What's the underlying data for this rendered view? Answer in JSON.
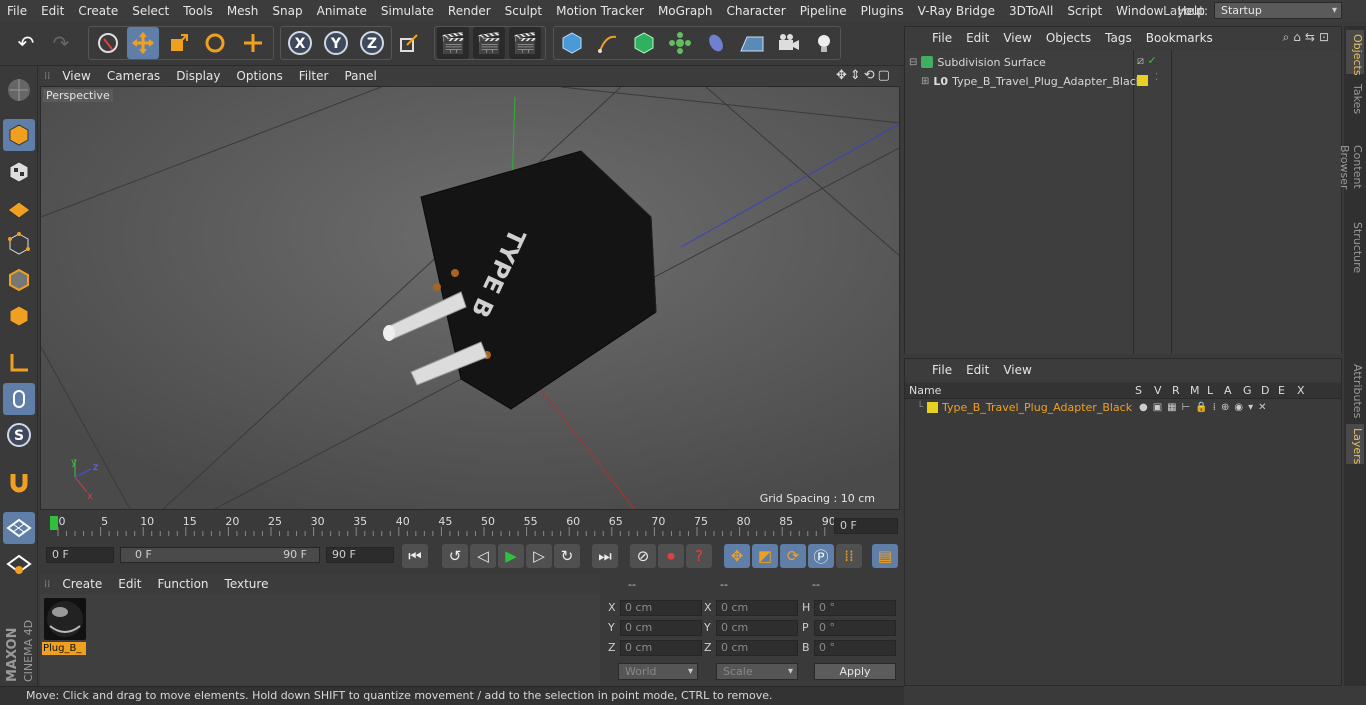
{
  "menubar": {
    "items": [
      "File",
      "Edit",
      "Create",
      "Select",
      "Tools",
      "Mesh",
      "Snap",
      "Animate",
      "Simulate",
      "Render",
      "Sculpt",
      "Motion Tracker",
      "MoGraph",
      "Character",
      "Pipeline",
      "Plugins",
      "V-Ray Bridge",
      "3DToAll",
      "Script",
      "Window",
      "Help"
    ],
    "layout_label": "Layout:",
    "layout_value": "Startup"
  },
  "viewport": {
    "menu": [
      "View",
      "Cameras",
      "Display",
      "Options",
      "Filter",
      "Panel"
    ],
    "label": "Perspective",
    "grid_spacing": "Grid Spacing : 10 cm",
    "object_text": "TYPE B"
  },
  "timeline": {
    "ticks": [
      "0",
      "5",
      "10",
      "15",
      "20",
      "25",
      "30",
      "35",
      "40",
      "45",
      "50",
      "55",
      "60",
      "65",
      "70",
      "75",
      "80",
      "85",
      "90"
    ],
    "current_frame": "0 F"
  },
  "transport": {
    "start_field": "0 F",
    "range_start": "0 F",
    "range_end": "90 F",
    "end_field": "90 F"
  },
  "material": {
    "menu": [
      "Create",
      "Edit",
      "Function",
      "Texture"
    ],
    "name": "Plug_B_"
  },
  "coords": {
    "headers": [
      "--",
      "--",
      "--"
    ],
    "rows": [
      {
        "a": "X",
        "av": "0 cm",
        "b": "X",
        "bv": "0 cm",
        "c": "H",
        "cv": "0 °"
      },
      {
        "a": "Y",
        "av": "0 cm",
        "b": "Y",
        "bv": "0 cm",
        "c": "P",
        "cv": "0 °"
      },
      {
        "a": "Z",
        "av": "0 cm",
        "b": "Z",
        "bv": "0 cm",
        "c": "B",
        "cv": "0 °"
      }
    ],
    "mode": "World",
    "scale": "Scale",
    "apply": "Apply"
  },
  "object_manager": {
    "menu": [
      "File",
      "Edit",
      "View",
      "Objects",
      "Tags",
      "Bookmarks"
    ],
    "objects": [
      {
        "name": "Subdivision Surface"
      },
      {
        "name": "Type_B_Travel_Plug_Adapter_Black"
      }
    ]
  },
  "layer_manager": {
    "menu": [
      "File",
      "Edit",
      "View"
    ],
    "headers": [
      "Name",
      "S",
      "V",
      "R",
      "M",
      "L",
      "A",
      "G",
      "D",
      "E",
      "X"
    ],
    "layer_name": "Type_B_Travel_Plug_Adapter_Black"
  },
  "side_tabs": [
    "Objects",
    "Takes",
    "Content Browser",
    "Structure",
    "Attributes",
    "Layers"
  ],
  "status": "Move: Click and drag to move elements. Hold down SHIFT to quantize movement / add to the selection in point mode, CTRL to remove.",
  "brand": {
    "line1": "MAXON",
    "line2": "CINEMA 4D"
  },
  "colors": {
    "accent": "#5f7ea8",
    "layer_yellow": "#e8d020",
    "highlight": "#f0a020"
  }
}
